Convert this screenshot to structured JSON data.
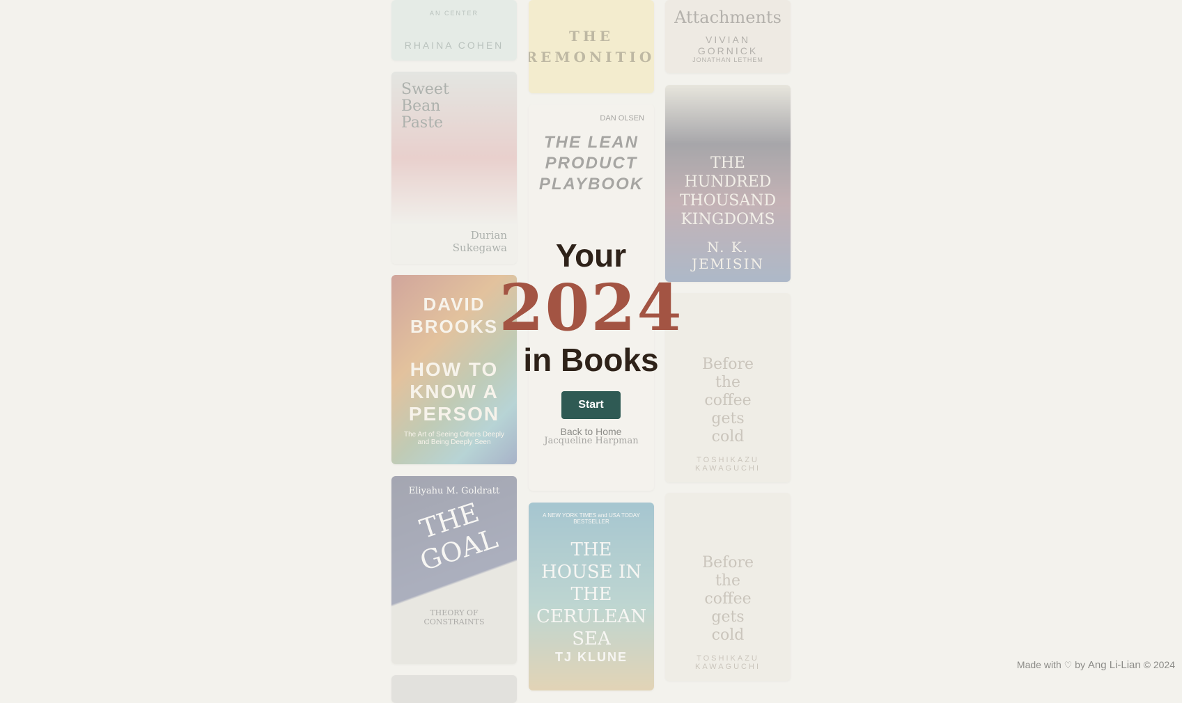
{
  "books": [
    {
      "title": "",
      "author": "RHAINA COHEN",
      "extra": "AN CENTER"
    },
    {
      "title": "THE PREMONITION",
      "author": "",
      "extra": ""
    },
    {
      "title": "Attachments",
      "author": "VIVIAN GORNICK",
      "extra": "JONATHAN LETHEM"
    },
    {
      "title": "Sweet Bean Paste",
      "author": "Durian Sukegawa",
      "extra": ""
    },
    {
      "title": "THE LEAN PRODUCT PLAYBOOK",
      "author": "DAN OLSEN",
      "extra": "Jacqueline Harpman"
    },
    {
      "title": "THE HUNDRED THOUSAND KINGDOMS",
      "author": "N. K. JEMISIN",
      "extra": ""
    },
    {
      "title": "HOW TO KNOW A PERSON",
      "author": "DAVID BROOKS",
      "extra": "The Art of Seeing Others Deeply and Being Deeply Seen"
    },
    {
      "title": "Before the coffee gets cold",
      "author": "TOSHIKAZU KAWAGUCHI",
      "extra": ""
    },
    {
      "title": "THE GOAL",
      "author": "Eliyahu M. Goldratt",
      "extra": "THEORY OF CONSTRAINTS"
    },
    {
      "title": "THE HOUSE IN THE CERULEAN SEA",
      "author": "TJ KLUNE",
      "extra": "A NEW YORK TIMES and USA TODAY BESTSELLER"
    },
    {
      "title": "Before the coffee gets cold",
      "author": "TOSHIKAZU KAWAGUCHI",
      "extra": ""
    }
  ],
  "hero": {
    "line1": "Your",
    "year": "2024",
    "line2": "in Books",
    "start_label": "Start",
    "back_label": "Back to Home"
  },
  "footer": {
    "made_with": "Made with",
    "heart": "♡",
    "by": "by",
    "author_link": "Ang Li-Lian",
    "copyright": "© 2024"
  }
}
